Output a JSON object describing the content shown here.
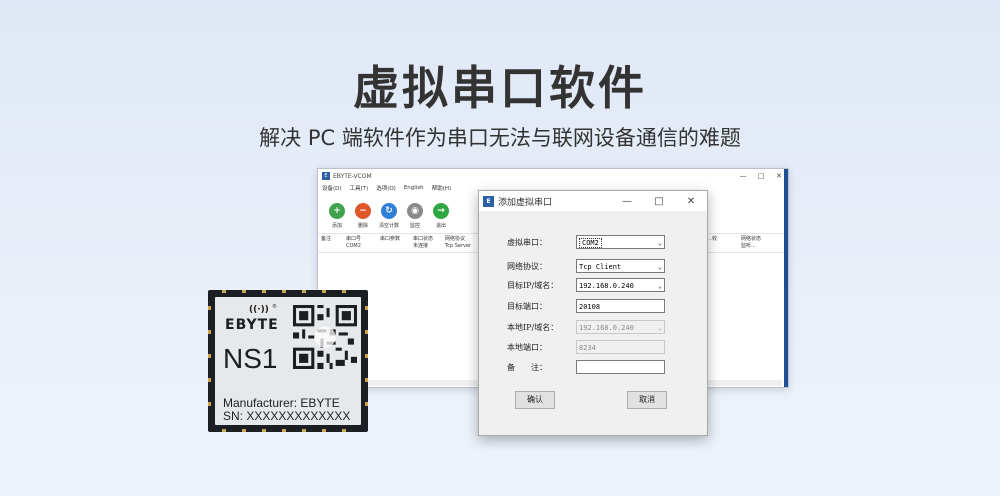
{
  "banner": {
    "title": "虚拟串口软件",
    "subtitle": "解决 PC 端软件作为串口无法与联网设备通信的难题"
  },
  "app": {
    "title": "EBYTE-VCOM",
    "menu": [
      "设备(D)",
      "工具(T)",
      "选项(O)",
      "English",
      "帮助(H)"
    ],
    "toolbar": [
      {
        "label": "添加",
        "icon": "add-icon",
        "color": "#3fa34d"
      },
      {
        "label": "删除",
        "icon": "delete-icon",
        "color": "#e0572b"
      },
      {
        "label": "清空计数",
        "icon": "reset-icon",
        "color": "#2f7fd6"
      },
      {
        "label": "监控",
        "icon": "monitor-icon",
        "color": "#8a8a8a"
      },
      {
        "label": "退出",
        "icon": "exit-icon",
        "color": "#2fa843"
      }
    ],
    "columns": [
      "备注",
      "串口号",
      "串口参数",
      "串口状态",
      "网络协议",
      "…收",
      "网络状态"
    ],
    "row": {
      "port": "COM2",
      "state": "未连接",
      "protocol": "Tcp Server",
      "net_state": "监听..."
    }
  },
  "dialog": {
    "title": "添加虚拟串口",
    "fields": [
      {
        "label": "虚拟串口：",
        "value": "COM2",
        "type": "select",
        "enabled": true
      },
      {
        "label": "网络协议：",
        "value": "Tcp Client",
        "type": "select",
        "enabled": true
      },
      {
        "label": "目标IP/域名：",
        "value": "192.168.0.240",
        "type": "select",
        "enabled": true
      },
      {
        "label": "目标端口：",
        "value": "20108",
        "type": "text",
        "enabled": true
      },
      {
        "label": "本地IP/域名：",
        "value": "192.168.0.240",
        "type": "select",
        "enabled": false
      },
      {
        "label": "本地端口：",
        "value": "8234",
        "type": "text",
        "enabled": false
      },
      {
        "label": "备　　注：",
        "value": "",
        "type": "text",
        "enabled": true
      }
    ],
    "ok_label": "确认",
    "cancel_label": "取消"
  },
  "chip": {
    "brand": "EBYTE",
    "model": "NS1",
    "manufacturer": "Manufacturer: EBYTE",
    "serial": "SN: XXXXXXXXXXXXX"
  }
}
